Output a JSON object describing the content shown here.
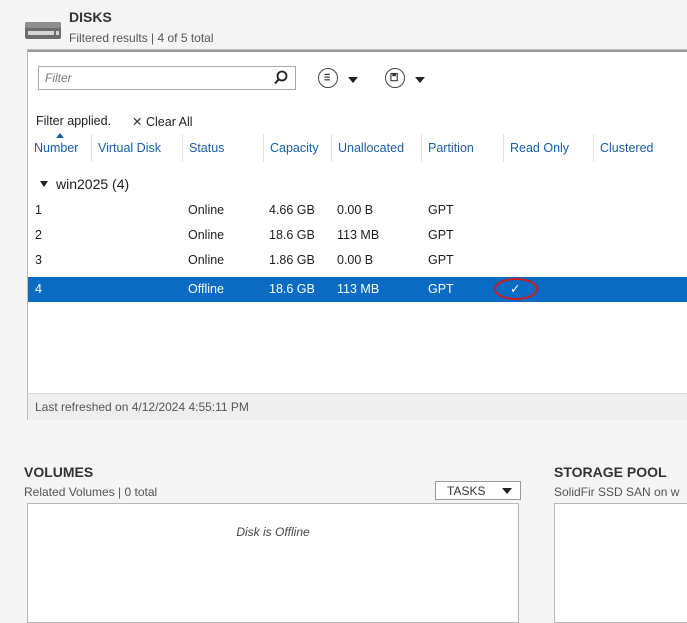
{
  "disks": {
    "title": "DISKS",
    "subtitle": "Filtered results | 4 of 5 total",
    "filter_placeholder": "Filter",
    "filter_applied_text": "Filter applied.",
    "clear_all_label": "Clear All",
    "columns": [
      "Number",
      "Virtual Disk",
      "Status",
      "Capacity",
      "Unallocated",
      "Partition",
      "Read Only",
      "Clustered"
    ],
    "group_label": "win2025 (4)",
    "rows": [
      {
        "number": "1",
        "virtual_disk": "",
        "status": "Online",
        "capacity": "4.66 GB",
        "unallocated": "0.00 B",
        "partition": "GPT",
        "read_only": "",
        "clustered": ""
      },
      {
        "number": "2",
        "virtual_disk": "",
        "status": "Online",
        "capacity": "18.6 GB",
        "unallocated": "113 MB",
        "partition": "GPT",
        "read_only": "",
        "clustered": ""
      },
      {
        "number": "3",
        "virtual_disk": "",
        "status": "Online",
        "capacity": "1.86 GB",
        "unallocated": "0.00 B",
        "partition": "GPT",
        "read_only": "",
        "clustered": ""
      },
      {
        "number": "4",
        "virtual_disk": "",
        "status": "Offline",
        "capacity": "18.6 GB",
        "unallocated": "113 MB",
        "partition": "GPT",
        "read_only": "✓",
        "clustered": ""
      }
    ],
    "selected_row_index": 3,
    "last_refreshed": "Last refreshed on 4/12/2024 4:55:11 PM"
  },
  "volumes": {
    "title": "VOLUMES",
    "subtitle": "Related Volumes | 0 total",
    "tasks_label": "TASKS",
    "empty_message": "Disk is Offline"
  },
  "storage_pool": {
    "title": "STORAGE POOL",
    "subtitle": "SolidFir SSD SAN on w"
  },
  "icons": {
    "disk": "disk-drive-icon",
    "search": "search-icon",
    "list_view": "list-view-icon",
    "save": "save-icon",
    "clear": "close-icon",
    "dropdown": "chevron-down-icon",
    "group_expand": "triangle-expanded-icon"
  },
  "colors": {
    "selection": "#0a6bc2",
    "header_text": "#1a5fa8",
    "annotation": "#d4161d"
  }
}
